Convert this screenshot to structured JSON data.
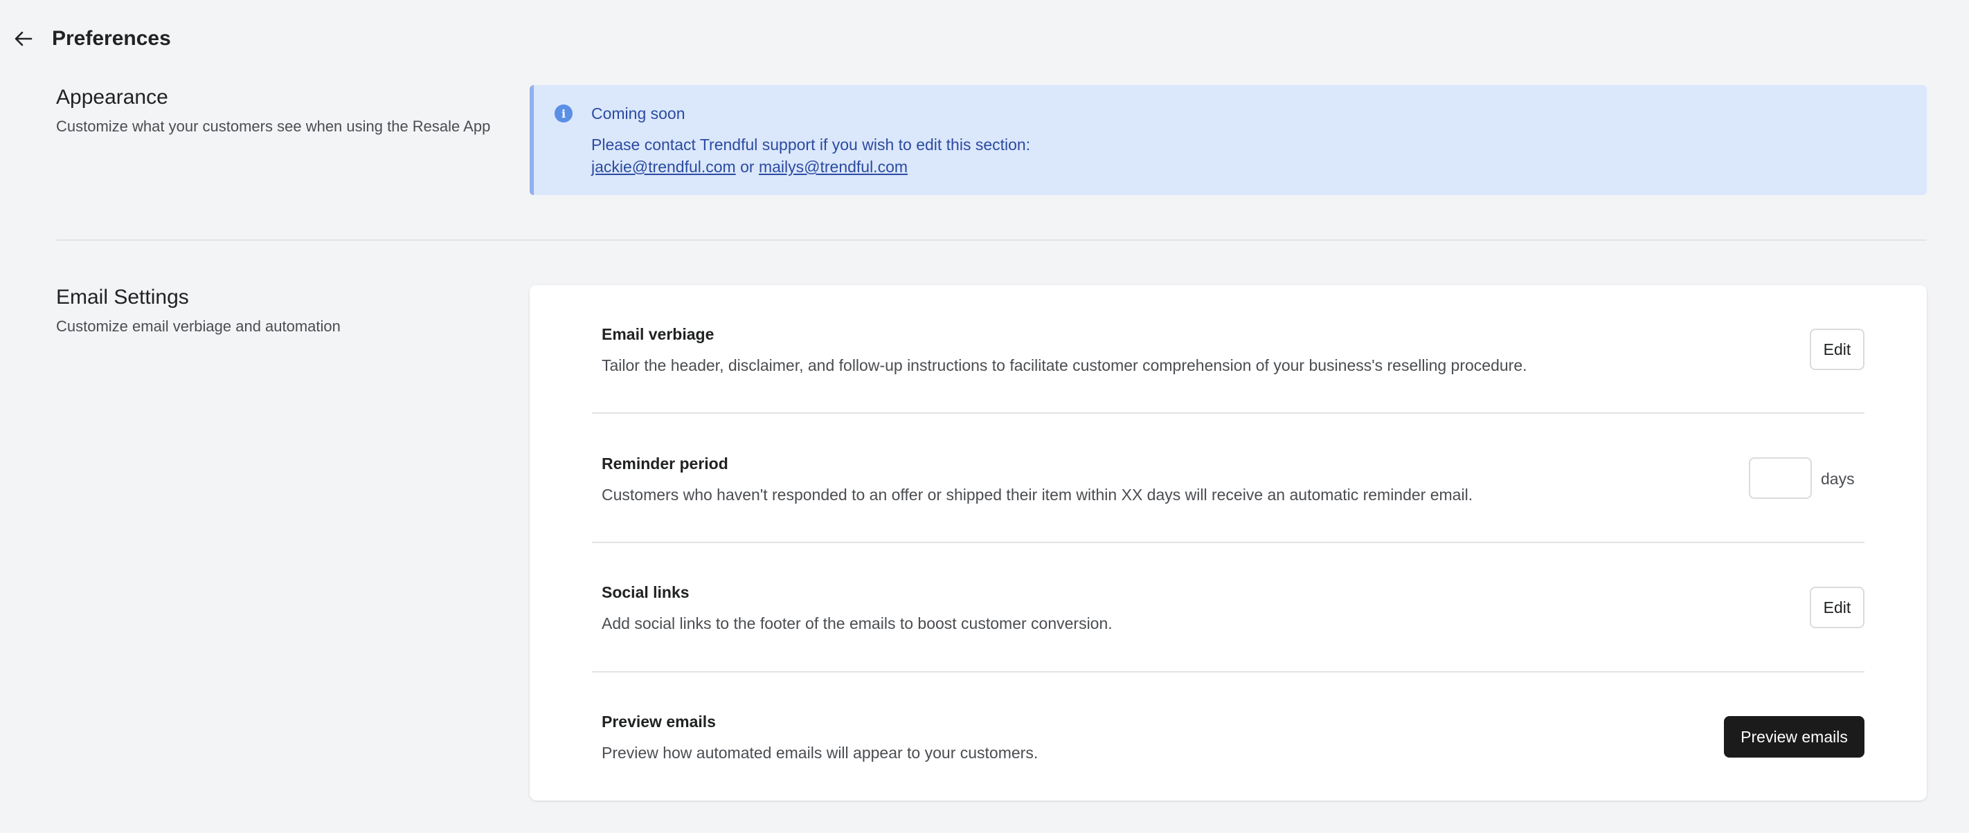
{
  "header": {
    "back_icon": "arrow-left-icon",
    "title": "Preferences"
  },
  "appearance": {
    "title": "Appearance",
    "description": "Customize what your customers see when using the Resale App",
    "banner": {
      "icon": "info-icon",
      "icon_glyph": "i",
      "title": "Coming soon",
      "text": "Please contact Trendful support if you wish to edit this section:",
      "email1": "jackie@trendful.com",
      "separator": "or",
      "email2": "mailys@trendful.com"
    }
  },
  "email_settings": {
    "title": "Email Settings",
    "description": "Customize email verbiage and automation",
    "rows": [
      {
        "title": "Email verbiage",
        "description": "Tailor the header, disclaimer, and follow-up instructions to facilitate customer comprehension of your business's reselling procedure.",
        "action_label": "Edit"
      },
      {
        "title": "Reminder period",
        "description": "Customers who haven't responded to an offer or shipped their item within XX days will receive an automatic reminder email.",
        "input_value": "",
        "unit_label": "days"
      },
      {
        "title": "Social links",
        "description": "Add social links to the footer of the emails to boost customer conversion.",
        "action_label": "Edit"
      },
      {
        "title": "Preview emails",
        "description": "Preview how automated emails will appear to your customers.",
        "action_label": "Preview emails"
      }
    ]
  },
  "colors": {
    "background": "#f3f4f6",
    "banner_bg": "#dbe7fb",
    "banner_text": "#2b4ba0",
    "primary_button": "#1b1b1b"
  }
}
